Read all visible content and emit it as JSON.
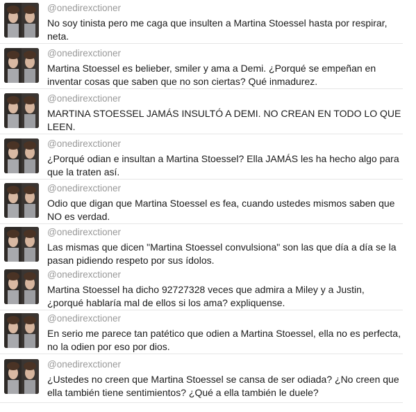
{
  "tweets": [
    {
      "handle": "@onedirexctioner",
      "text": "No soy tinista pero me caga que insulten a Martina Stoessel hasta por respirar, neta."
    },
    {
      "handle": "@onedirexctioner",
      "text": "Martina Stoessel es belieber, smiler y ama a Demi. ¿Porqué se empeñan en inventar cosas que saben que no son ciertas? Qué inmadurez."
    },
    {
      "handle": "@onedirexctioner",
      "text": "MARTINA STOESSEL JAMÁS INSULTÓ A DEMI. NO CREAN EN TODO LO QUE LEEN."
    },
    {
      "handle": "@onedirexctioner",
      "text": "¿Porqué odian e insultan a Martina Stoessel? Ella JAMÁS les ha hecho algo para que la traten así."
    },
    {
      "handle": "@onedirexctioner",
      "text": "Odio que digan que Martina Stoessel es fea, cuando ustedes mismos saben que NO es verdad."
    },
    {
      "handle": "@onedirexctioner",
      "text": "Las mismas que dicen \"Martina Stoessel convulsiona\" son las que día a día se la pasan pidiendo respeto por sus ídolos."
    },
    {
      "handle": "@onedirexctioner",
      "text": "Martina Stoessel ha dicho 92727328 veces que admira a Miley y a Justin, ¿porqué hablaría mal de ellos si los ama? expliquense."
    },
    {
      "handle": "@onedirexctioner",
      "text": "En serio me parece tan patético que odien a Martina Stoessel, ella no es perfecta, no la odien por eso por dios."
    },
    {
      "handle": "@onedirexctioner",
      "text": "¿Ustedes no creen que Martina Stoessel se cansa de ser odiada? ¿No creen que ella también tiene sentimientos? ¿Qué a ella también le duele?"
    }
  ]
}
